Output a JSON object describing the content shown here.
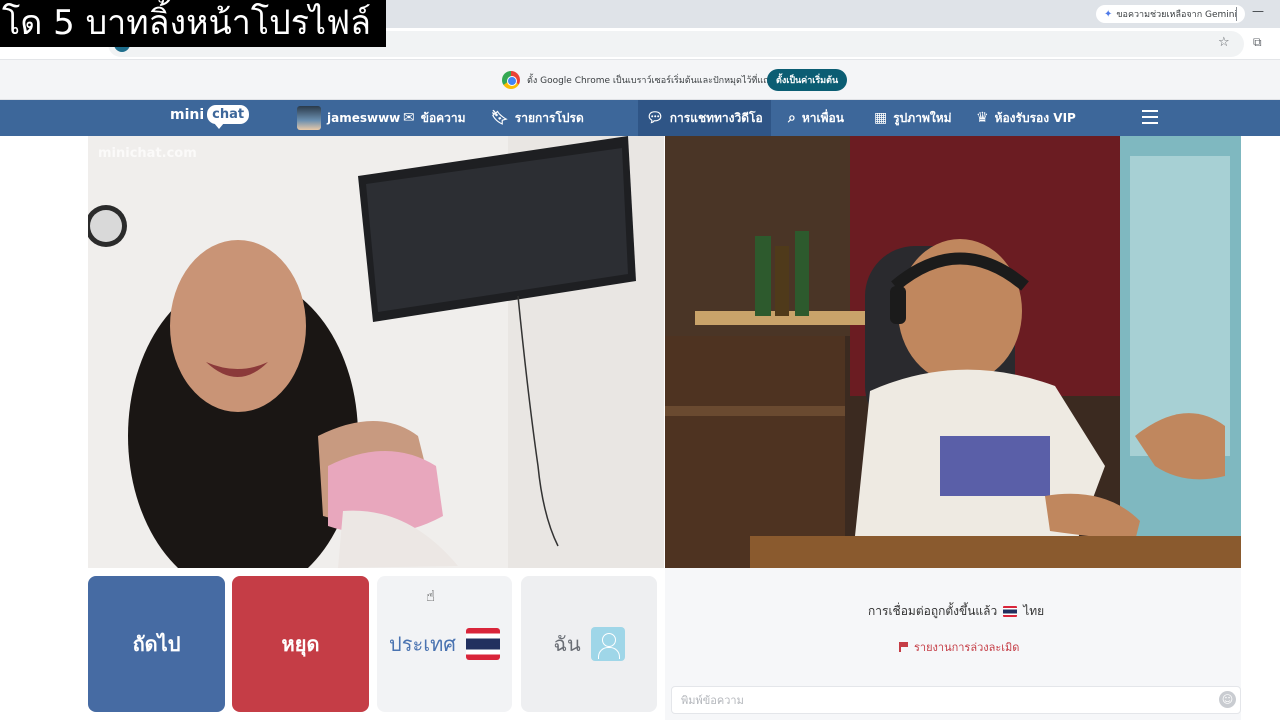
{
  "overlay": {
    "caption": "โด 5 บาทลิ้งหน้าโปรไฟล์"
  },
  "browser": {
    "gemini_chip": "ขอความช่วยเหลือจาก Gemini",
    "infobar": {
      "message": "ตั้ง Google Chrome เป็นเบราว์เซอร์เริ่มต้นและปักหมุดไว้ที่แถบงาน",
      "button": "ตั้งเป็นค่าเริ่มต้น"
    },
    "icons": {
      "star": "star-icon",
      "extensions": "puzzle-icon",
      "minimize": "minimize-icon"
    }
  },
  "nav": {
    "logo_left": "mini",
    "logo_right": "chat",
    "username": "jameswww",
    "messages": "ข้อความ",
    "favorites": "รายการโปรด",
    "video_chat": "การแชททางวิดีโอ",
    "find_friends": "หาเพื่อน",
    "new_photos": "รูปภาพใหม่",
    "vip_room": "ห้องรับรอง VIP"
  },
  "video": {
    "watermark": "minichat.com"
  },
  "controls": {
    "next": "ถัดไป",
    "stop": "หยุด",
    "country": "ประเทศ",
    "me": "ฉัน"
  },
  "chat": {
    "status": "การเชื่อมต่อถูกตั้งขึ้นแล้ว",
    "country": "ไทย",
    "report": "รายงานการล่วงละเมิด",
    "input_placeholder": "พิมพ์ข้อความ"
  },
  "colors": {
    "nav_bg": "#3d679a",
    "next_bg": "#466ba3",
    "stop_bg": "#c53d46",
    "infobar_button": "#0b5d73"
  }
}
